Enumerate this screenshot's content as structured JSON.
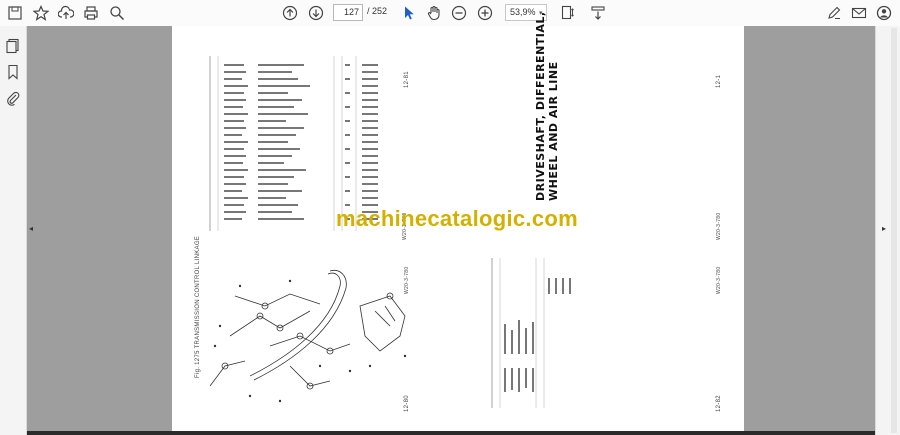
{
  "toolbar": {
    "page_current": "127",
    "page_total": "/ 252",
    "zoom_level": "53,9%"
  },
  "left_page": {
    "figure_caption": "Fig. 1275 TRANSMISSION CONTROL LINKAGE",
    "code_bottom": "W20-3-780",
    "code_top": "W20-3-780",
    "page_num_top": "12-81",
    "page_num_bottom": "12-80"
  },
  "right_page": {
    "heading_line1": "DRIVESHAFT, DIFFERENTIAL,",
    "heading_line2": "WHEEL AND AIR LINE",
    "code_top": "W20-3-780",
    "code_bottom": "W20-3-780",
    "page_num_top": "12-1",
    "page_num_bottom": "12-82"
  },
  "watermark": "machinecatalogic.com"
}
